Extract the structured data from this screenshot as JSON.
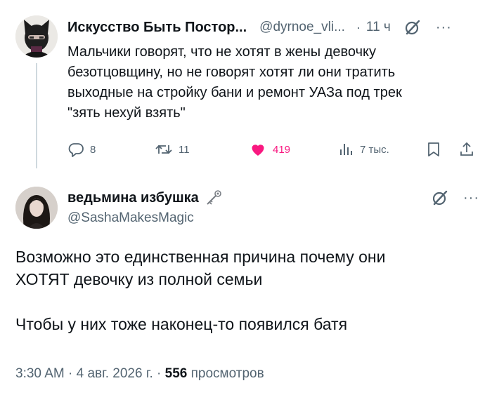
{
  "quoted_tweet": {
    "display_name": "Искусство Быть Постор...",
    "handle": "@dyrnoe_vli...",
    "time": "11 ч",
    "text_lines": [
      "Мальчики говорят, что не хотят в жены девочку",
      "безотцовщину, но не говорят хотят ли они тратить",
      "выходные на стройку бани и ремонт УАЗа под трек",
      "\"зять нехуй взять\""
    ],
    "replies": "8",
    "retweets": "11",
    "likes": "419",
    "views": "7 тыс."
  },
  "reply_tweet": {
    "display_name": "ведьмина избушка",
    "handle": "@SashaMakesMagic",
    "text_lines": [
      "Возможно это единственная причина почему они",
      "ХОТЯТ девочку из полной семьи",
      "",
      "Чтобы у них тоже наконец-то появился батя"
    ],
    "time": "3:30 AM",
    "date": "4 авг. 2026 г.",
    "views_count": "556",
    "views_label": "просмотров"
  },
  "icons": [
    "avatar",
    "grok-icon",
    "more-icon",
    "reply-icon",
    "retweet-icon",
    "heart-icon",
    "views-icon",
    "bookmark-icon",
    "share-icon",
    "key-icon"
  ],
  "colors": {
    "text": "#0f1419",
    "secondary": "#536471",
    "like": "#f91880",
    "line": "#cfd9de"
  }
}
